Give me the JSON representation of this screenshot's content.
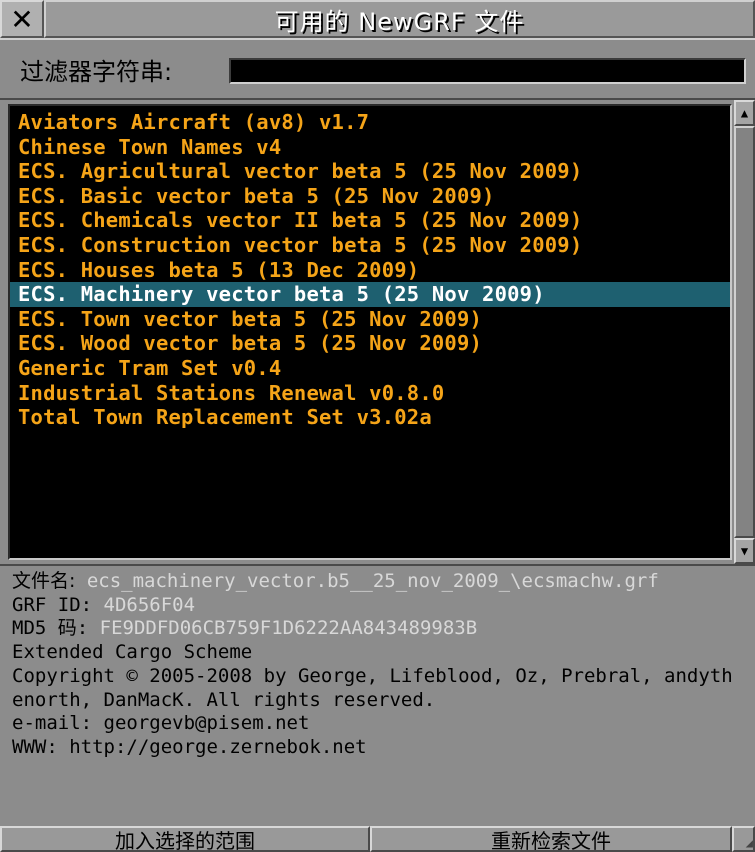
{
  "window": {
    "close_glyph": "✕",
    "title": "可用的 NewGRF 文件"
  },
  "filter": {
    "label": "过滤器字符串:",
    "value": ""
  },
  "list": {
    "items": [
      "Aviators Aircraft (av8) v1.7",
      "Chinese Town Names v4",
      "ECS. Agricultural vector beta 5 (25 Nov 2009)",
      "ECS. Basic vector beta 5 (25 Nov 2009)",
      "ECS. Chemicals vector II beta 5 (25 Nov 2009)",
      "ECS. Construction vector beta 5 (25 Nov 2009)",
      "ECS. Houses beta 5 (13 Dec 2009)",
      "ECS. Machinery vector beta 5 (25 Nov 2009)",
      "ECS. Town vector beta 5 (25 Nov 2009)",
      "ECS. Wood vector beta 5 (25 Nov 2009)",
      "Generic Tram Set v0.4",
      "Industrial Stations Renewal v0.8.0",
      "Total Town Replacement Set v3.02a"
    ],
    "selected_index": 7
  },
  "info": {
    "filename_label": "文件名:",
    "filename_value": "ecs_machinery_vector.b5__25_nov_2009_\\ecsmachw.grf",
    "grfid_label": "GRF ID:",
    "grfid_value": "4D656F04",
    "md5_label": "MD5 码:",
    "md5_value": "FE9DDFD06CB759F1D6222AA843489983B",
    "description": "Extended Cargo Scheme",
    "copyright": "Copyright © 2005-2008 by George, Lifeblood, Oz, Prebral, andythenorth, DanMacK. All rights reserved.",
    "email": "e-mail: georgevb@pisem.net",
    "www": "WWW: http://george.zernebok.net"
  },
  "buttons": {
    "add": "加入选择的范围",
    "rescan": "重新检索文件"
  },
  "colors": {
    "list_text": "#f5a418",
    "selected_bg": "#1e6070",
    "panel_bg": "#8c8c8c",
    "title_text": "#ffffff"
  }
}
